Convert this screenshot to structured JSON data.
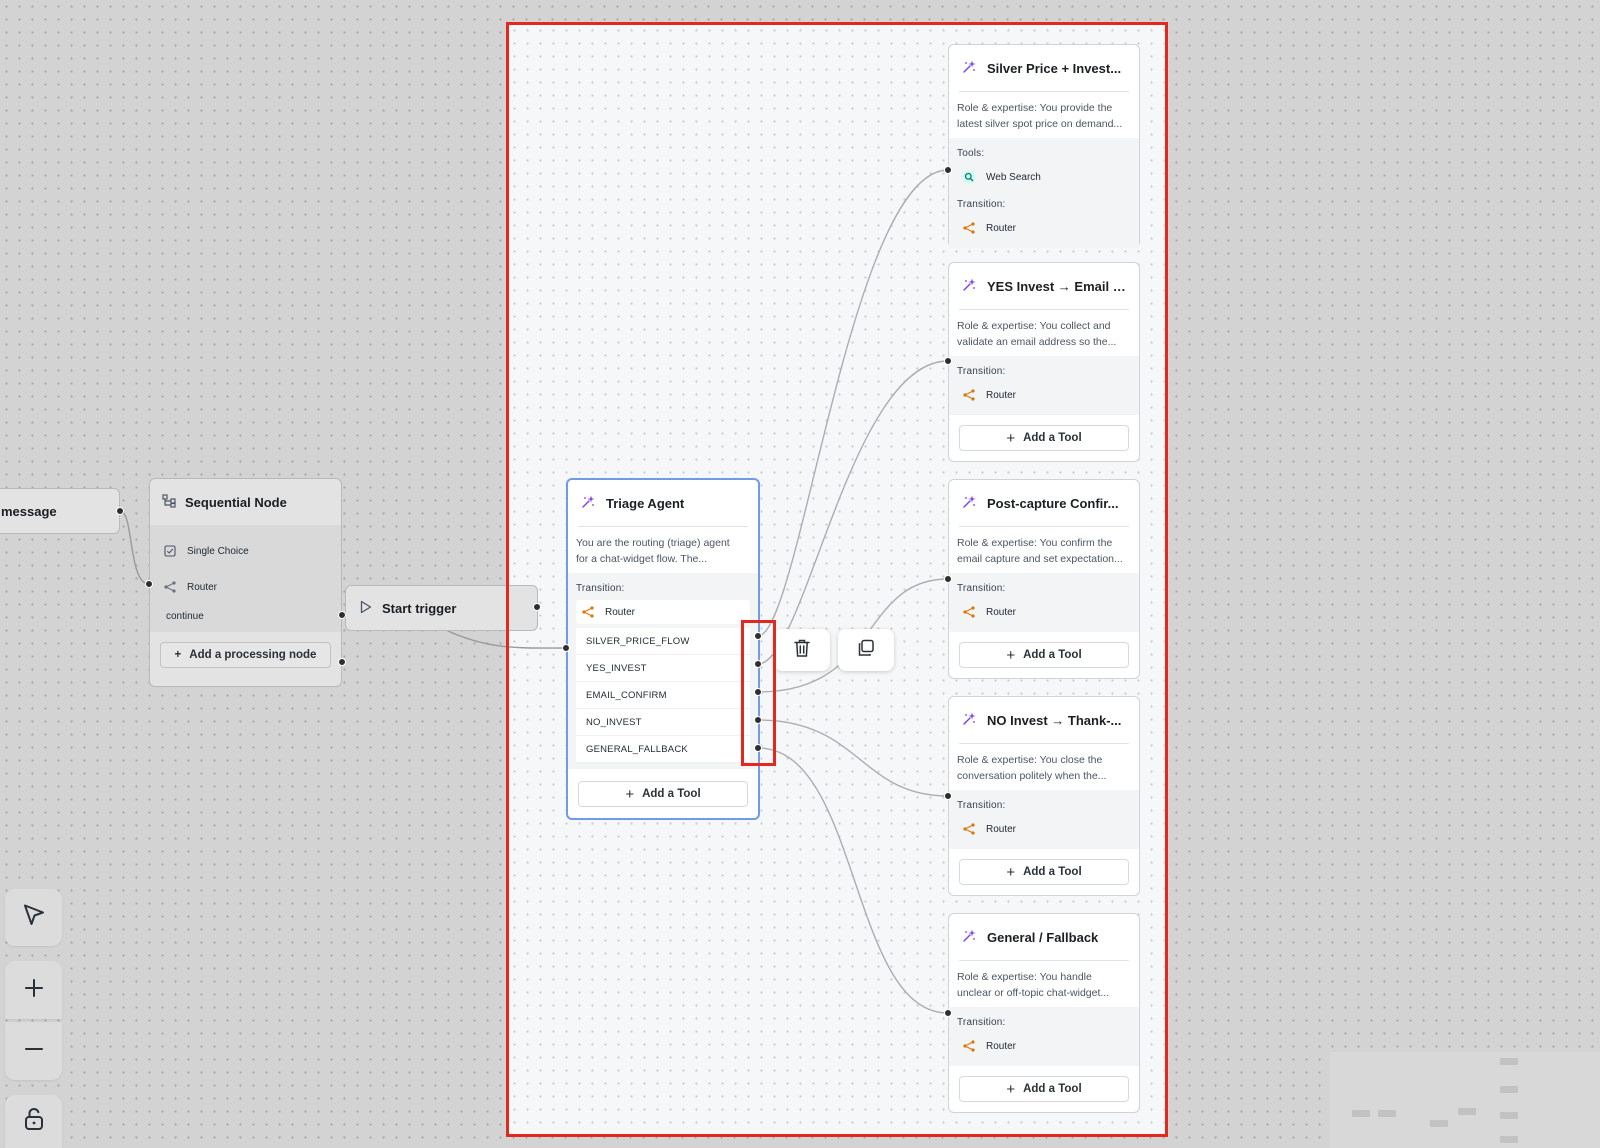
{
  "colors": {
    "canvas_bg": "#d3d3d3",
    "highlight_bg": "#f6f7f8",
    "red_frame": "#e4281e",
    "selected_border": "#6f9be8",
    "agent_icon": "#7c3aed",
    "router_icon": "#d97706",
    "web_search_icon": "#0f766e"
  },
  "message_node": {
    "label": "message"
  },
  "sequential_node": {
    "title": "Sequential Node",
    "items": [
      {
        "icon": "checkbox-icon",
        "label": "Single Choice"
      },
      {
        "icon": "router-icon",
        "label": "Router"
      }
    ],
    "route": "continue",
    "add_label": "Add a processing node"
  },
  "start_trigger": {
    "label": "Start trigger"
  },
  "triage_agent": {
    "title": "Triage Agent",
    "description_line1": "You are the routing (triage) agent",
    "description_line2": "for a chat-widget flow. The...",
    "transition_label": "Transition:",
    "router_label": "Router",
    "routes": [
      "SILVER_PRICE_FLOW",
      "YES_INVEST",
      "EMAIL_CONFIRM",
      "NO_INVEST",
      "GENERAL_FALLBACK"
    ],
    "add_tool_label": "Add a Tool"
  },
  "floating_actions": {
    "delete_icon": "trash-icon",
    "duplicate_icon": "copy-icon"
  },
  "agents": [
    {
      "title": "Silver Price + Invest...",
      "description_line1": "Role & expertise: You provide the",
      "description_line2": "latest silver spot price on demand...",
      "tools_label": "Tools:",
      "tool_name": "Web Search",
      "transition_label": "Transition:",
      "router_label": "Router"
    },
    {
      "title": "YES Invest → Email I...",
      "description_line1": "Role & expertise: You collect and",
      "description_line2": "validate an email address so the...",
      "transition_label": "Transition:",
      "router_label": "Router",
      "add_tool_label": "Add a Tool"
    },
    {
      "title": "Post-capture Confir...",
      "description_line1": "Role & expertise: You confirm the",
      "description_line2": "email capture and set expectation...",
      "transition_label": "Transition:",
      "router_label": "Router",
      "add_tool_label": "Add a Tool"
    },
    {
      "title": "NO Invest → Thank-...",
      "description_line1": "Role & expertise: You close the",
      "description_line2": "conversation politely when the...",
      "transition_label": "Transition:",
      "router_label": "Router",
      "add_tool_label": "Add a Tool"
    },
    {
      "title": "General / Fallback",
      "description_line1": "Role & expertise: You handle",
      "description_line2": "unclear or off-topic chat-widget...",
      "transition_label": "Transition:",
      "router_label": "Router",
      "add_tool_label": "Add a Tool"
    }
  ],
  "toolbar": {
    "select": "cursor-icon",
    "zoom_in": "plus-icon",
    "zoom_out": "minus-icon",
    "lock": "unlock-icon"
  }
}
